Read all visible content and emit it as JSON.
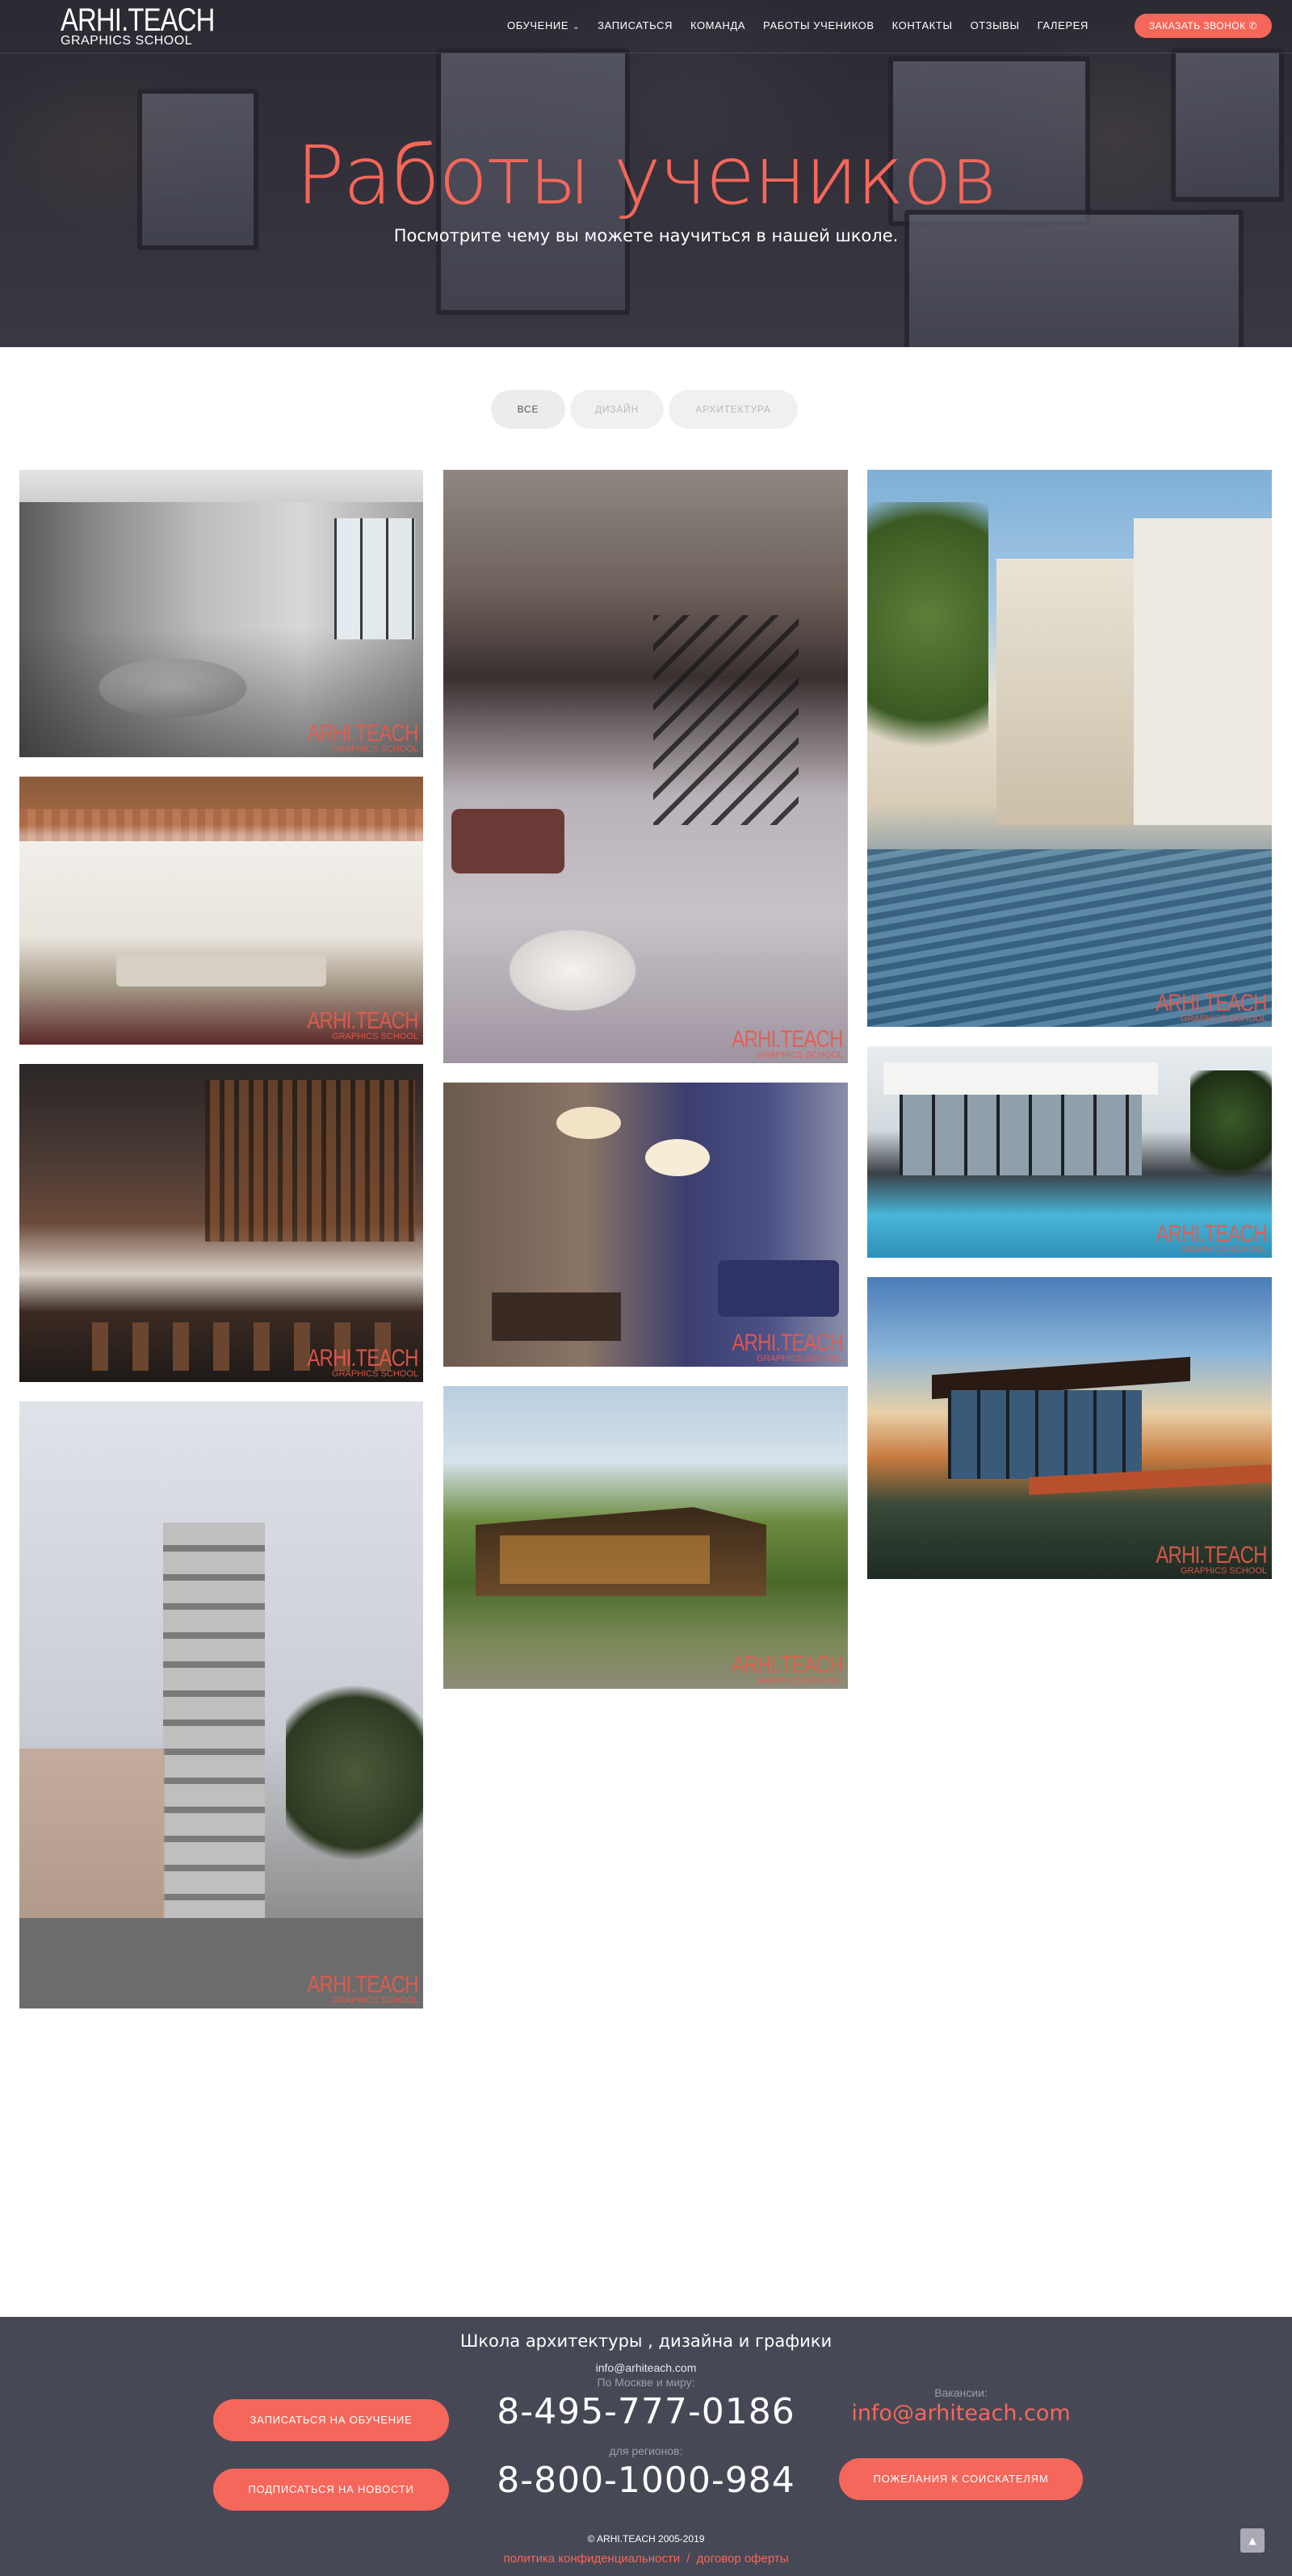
{
  "header": {
    "logo_main": "ARHI.TEACH",
    "logo_sub": "GRAPHICS SCHOOL",
    "nav": [
      {
        "label": "ОБУЧЕНИЕ",
        "has_dropdown": true
      },
      {
        "label": "ЗАПИСАТЬСЯ"
      },
      {
        "label": "КОМАНДА"
      },
      {
        "label": "РАБОТЫ УЧЕНИКОВ"
      },
      {
        "label": "КОНТАКТЫ"
      },
      {
        "label": "ОТЗЫВЫ"
      },
      {
        "label": "ГАЛЕРЕЯ"
      }
    ],
    "call_button": "ЗАКАЗАТЬ ЗВОНОК",
    "call_icon": "phone-icon"
  },
  "hero": {
    "title": "Работы учеников",
    "subtitle": "Посмотрите чему вы можете научиться в нашей школе."
  },
  "filters": [
    {
      "label": "ВСЕ",
      "active": true
    },
    {
      "label": "ДИЗАЙН",
      "active": false
    },
    {
      "label": "АРХИТЕКТУРА",
      "active": false
    }
  ],
  "gallery": {
    "watermark_main": "ARHI.TEACH",
    "watermark_sub": "GRAPHICS SCHOOL"
  },
  "footer": {
    "title": "Школа архитектуры , дизайна и графики",
    "email": "info@arhiteach.com",
    "moscow_label": "По Москве и миру:",
    "phone_moscow": "8-495-777-0186",
    "regions_label": "для регионов:",
    "phone_regions": "8-800-1000-984",
    "signup_button": "ЗАПИСАТЬСЯ НА ОБУЧЕНИЕ",
    "subscribe_button": "ПОДПИСАТЬСЯ НА НОВОСТИ",
    "vacancies_label": "Вакансии:",
    "vacancies_email": "info@arhiteach.com",
    "applicants_button": "ПОЖЕЛАНИЯ К СОИСКАТЕЛЯМ",
    "copyright": "© ARHI.TEACH 2005-2019",
    "privacy_link": "политика конфиденциальности",
    "link_separator": "/",
    "offer_link": "договор оферты",
    "to_top_icon": "chevron-up-icon"
  },
  "colors": {
    "accent": "#f5675a",
    "footer_bg": "#474856",
    "filter_bg": "#f0f0f0"
  }
}
